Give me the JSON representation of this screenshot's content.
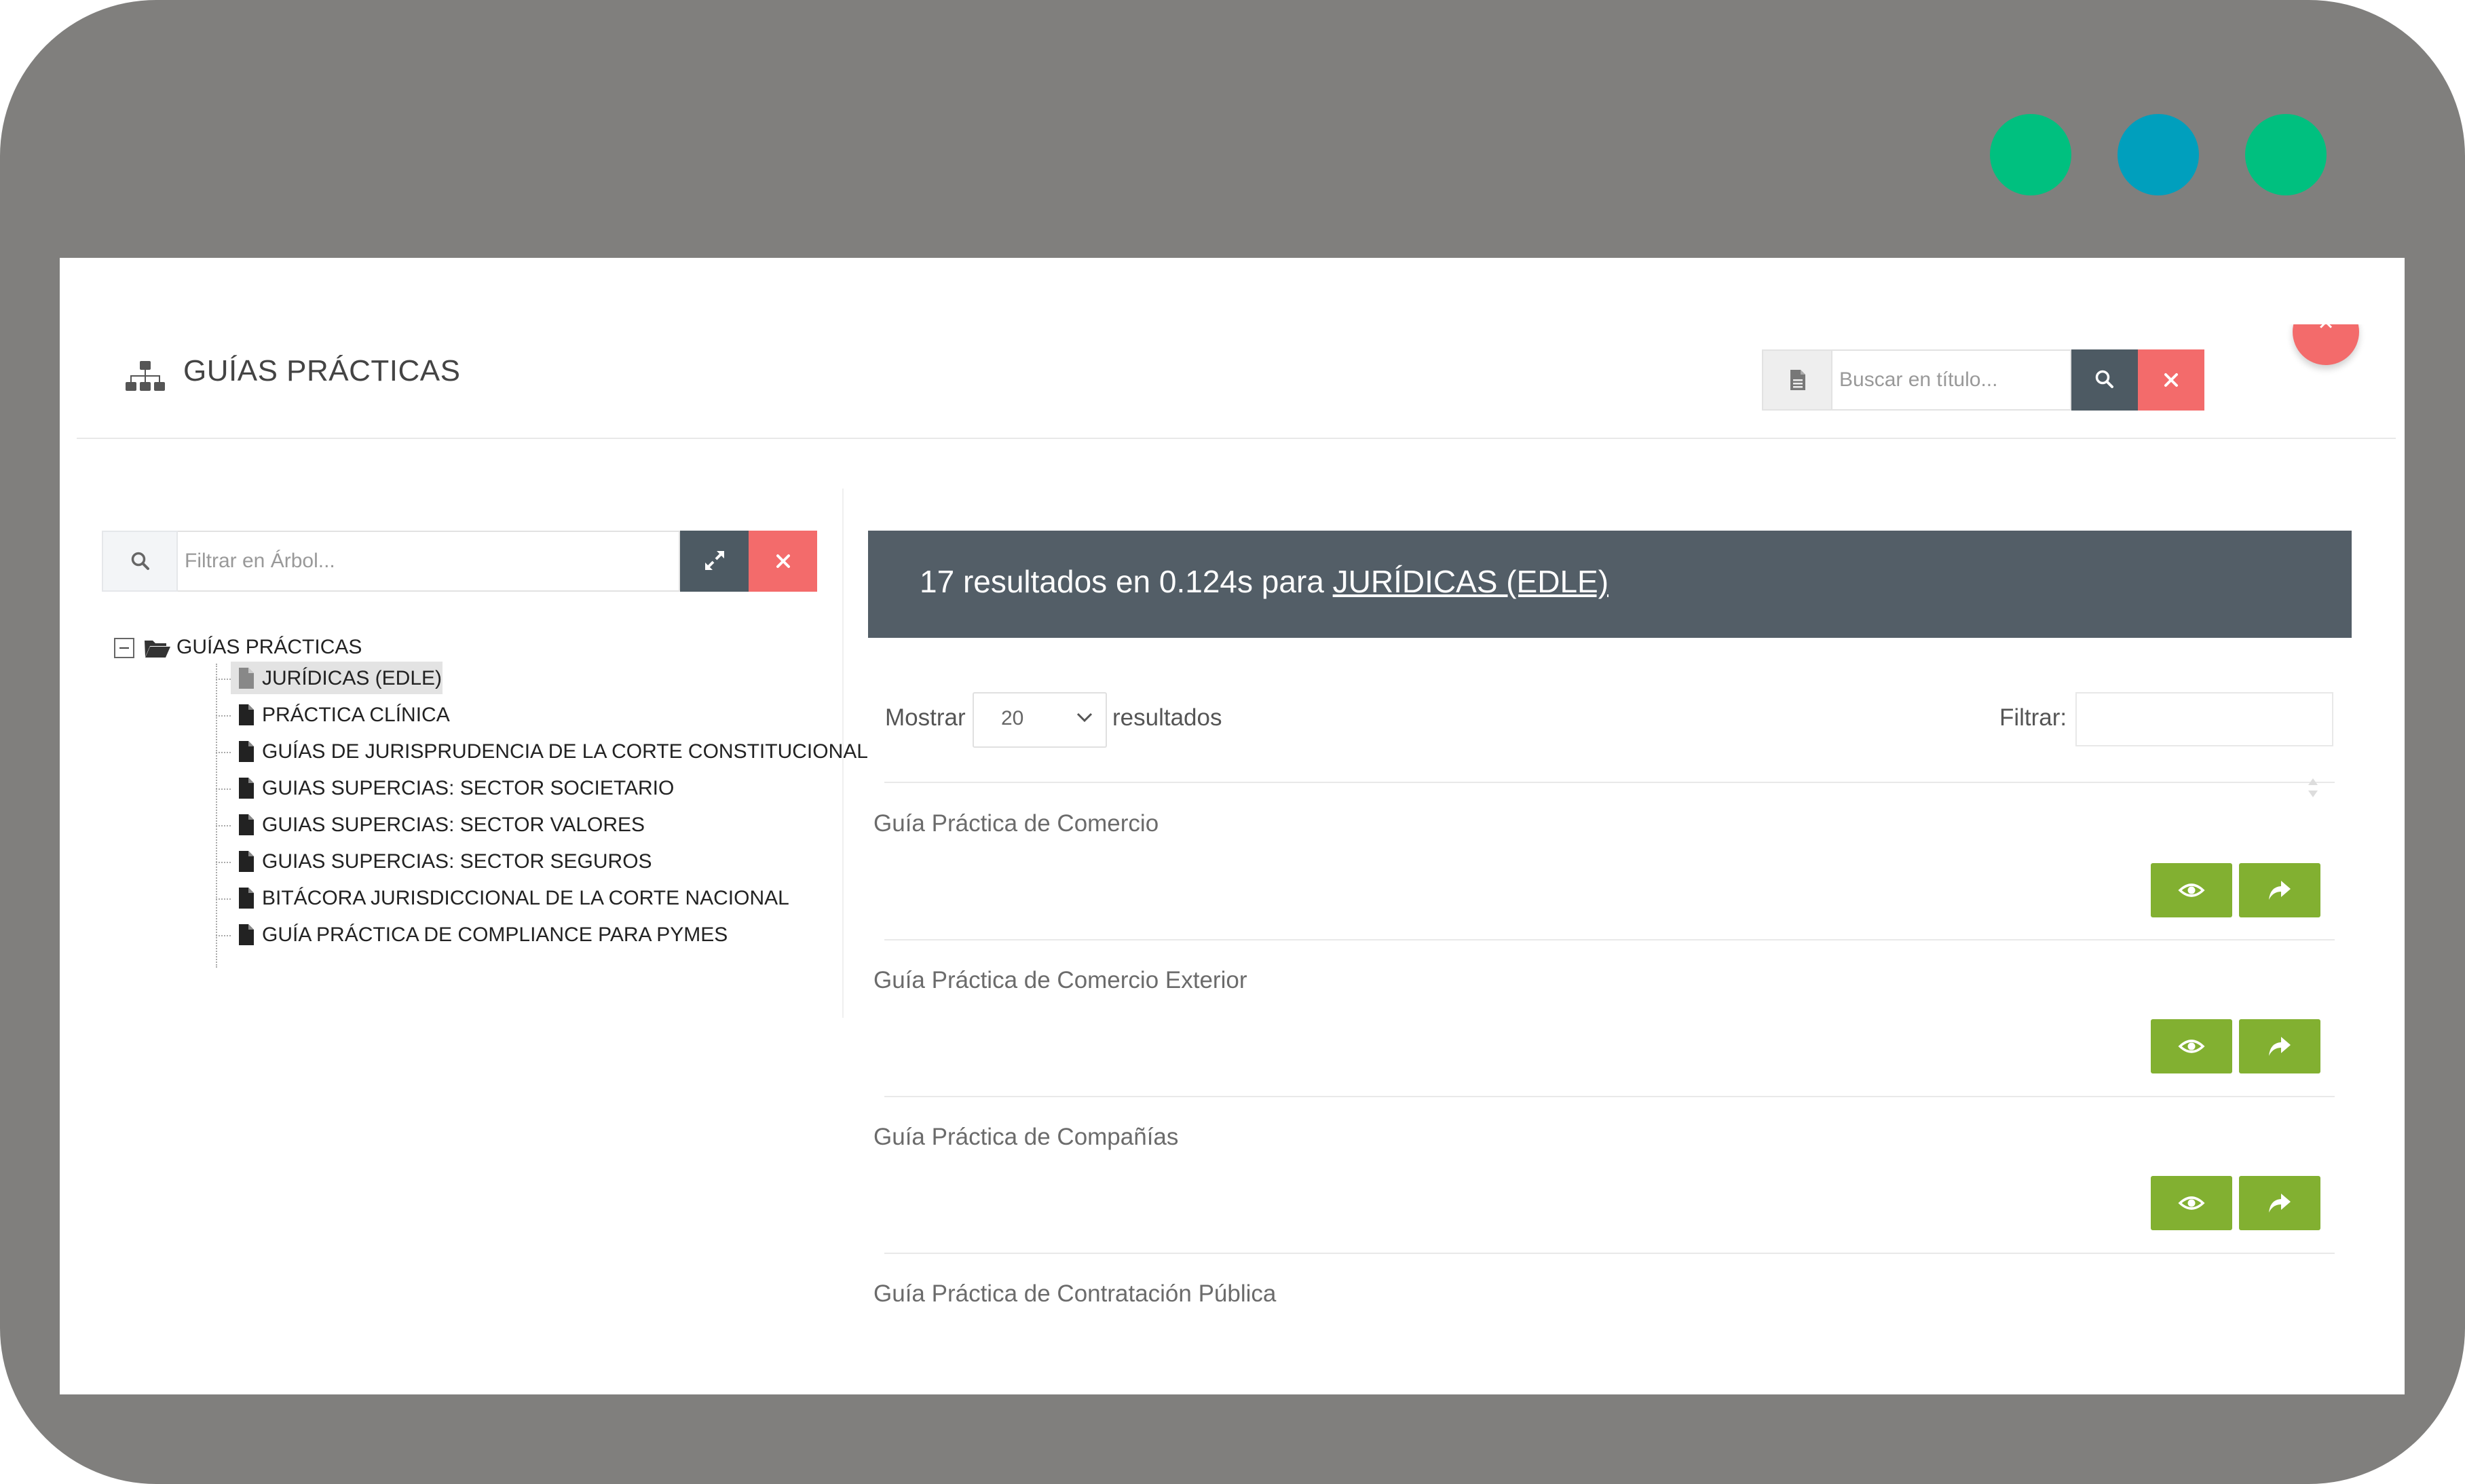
{
  "colors": {
    "frame": "#807f7d",
    "dot_green": "#00c07f",
    "dot_teal": "#009fbd",
    "header_dark": "#535e67",
    "button_dark": "#4d5a63",
    "button_red": "#f36b6b",
    "button_green": "#82b031"
  },
  "header": {
    "icon": "sitemap-icon",
    "title": "GUÍAS PRÁCTICAS",
    "close_icon": "close-icon"
  },
  "title_search": {
    "addon_icon": "document-icon",
    "placeholder": "Buscar en título...",
    "search_icon": "search-icon",
    "clear_icon": "close-icon"
  },
  "tree_filter": {
    "addon_icon": "search-icon",
    "placeholder": "Filtrar en Árbol...",
    "expand_icon": "expand-icon",
    "clear_icon": "close-icon"
  },
  "tree": {
    "root_label": "GUÍAS PRÁCTICAS",
    "root_icon": "folder-open-icon",
    "items": [
      {
        "label": "JURÍDICAS (EDLE)",
        "selected": true
      },
      {
        "label": "PRÁCTICA CLÍNICA",
        "selected": false
      },
      {
        "label": "GUÍAS DE JURISPRUDENCIA DE LA CORTE CONSTITUCIONAL",
        "selected": false
      },
      {
        "label": "GUIAS SUPERCIAS: SECTOR SOCIETARIO",
        "selected": false
      },
      {
        "label": "GUIAS SUPERCIAS: SECTOR VALORES",
        "selected": false
      },
      {
        "label": "GUIAS SUPERCIAS: SECTOR SEGUROS",
        "selected": false
      },
      {
        "label": "BITÁCORA JURISDICCIONAL DE LA CORTE NACIONAL",
        "selected": false
      },
      {
        "label": "GUÍA PRÁCTICA DE COMPLIANCE PARA PYMES",
        "selected": false
      }
    ]
  },
  "results": {
    "summary_prefix": "17 resultados en 0.124s para ",
    "summary_link": "JURÍDICAS (EDLE)",
    "show_label": "Mostrar",
    "page_size": "20",
    "results_label": "resultados",
    "filter_label": "Filtrar:",
    "rows": [
      {
        "title": "Guía Práctica de Comercio"
      },
      {
        "title": "Guía Práctica de Comercio Exterior"
      },
      {
        "title": "Guía Práctica de Compañías"
      },
      {
        "title": "Guía Práctica de Contratación Pública"
      }
    ],
    "view_icon": "eye-icon",
    "share_icon": "share-icon"
  }
}
